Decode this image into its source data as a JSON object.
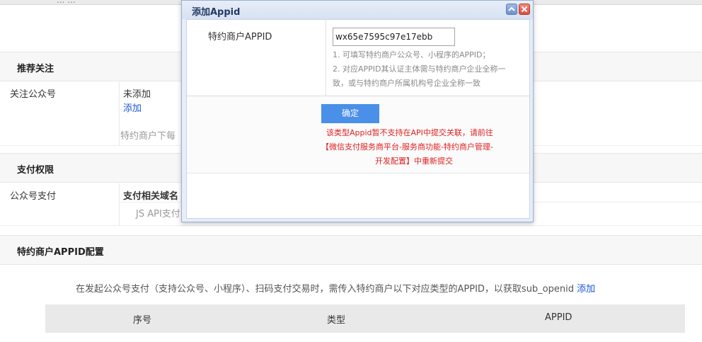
{
  "topbar": {
    "partial_text": "... ..."
  },
  "sections": {
    "recommend": {
      "title": "推荐关注",
      "row_label": "关注公众号",
      "status": "未添加",
      "add_link": "添加",
      "note_partial": "特约商户下每"
    },
    "payment": {
      "title": "支付权限",
      "row_label": "公众号支付",
      "col_header": "支付相关域名",
      "jsapi_partial": "JS API支付"
    },
    "appid_config": {
      "title": "特约商户APPID配置",
      "description": "在发起公众号支付（支持公众号、小程序）、扫码支付交易时，需传入特约商户以下对应类型的APPID，以获取sub_openid",
      "add_link": "添加",
      "table_headers": [
        "序号",
        "类型",
        "APPID"
      ]
    }
  },
  "modal": {
    "title": "添加Appid",
    "field_label": "特约商户APPID",
    "appid_value": "wx65e7595c97e17ebb",
    "hints": [
      "1. 可填写特约商户公众号、小程序的APPID；",
      "2. 对应APPID其认证主体需与特约商户企业全称一",
      "致，或与特约商户所属机构号企业全称一致"
    ],
    "confirm_label": "确定",
    "error_lines": [
      "该类型Appid暂不支持在API中提交关联，请前往",
      "【微信支付服务商平台-服务商功能-特约商户管理-",
      "开发配置】中重新提交"
    ],
    "colors": {
      "error": "#e02020",
      "confirm": "#4a90e8",
      "link": "#1a56d6"
    }
  }
}
